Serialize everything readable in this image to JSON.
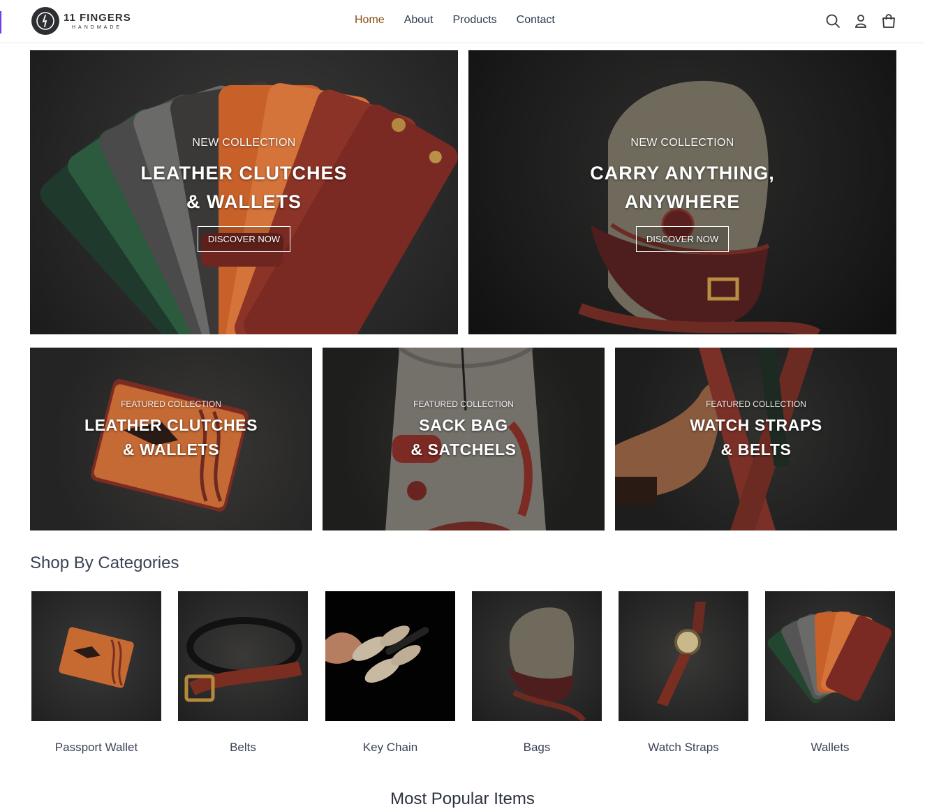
{
  "brand": {
    "name": "11 FINGERS",
    "sub": "HANDMADE"
  },
  "nav": [
    {
      "label": "Home",
      "active": true
    },
    {
      "label": "About",
      "active": false
    },
    {
      "label": "Products",
      "active": false
    },
    {
      "label": "Contact",
      "active": false
    }
  ],
  "header_icons": [
    "search-icon",
    "account-icon",
    "cart-icon"
  ],
  "hero": [
    {
      "kicker": "NEW COLLECTION",
      "title_line1": "LEATHER CLUTCHES",
      "title_line2": "& WALLETS",
      "button": "DISCOVER NOW"
    },
    {
      "kicker": "NEW COLLECTION",
      "title_line1": "CARRY ANYTHING,",
      "title_line2": "ANYWHERE",
      "button": "DISCOVER NOW"
    }
  ],
  "featured": [
    {
      "kicker": "FEATURED COLLECTION",
      "title_line1": "LEATHER CLUTCHES",
      "title_line2": "& WALLETS"
    },
    {
      "kicker": "FEATURED COLLECTION",
      "title_line1": "SACK BAG",
      "title_line2": "& SATCHELS"
    },
    {
      "kicker": "FEATURED COLLECTION",
      "title_line1": "WATCH STRAPS",
      "title_line2": "& BELTS"
    }
  ],
  "categories": {
    "title": "Shop By Categories",
    "items": [
      {
        "label": "Passport Wallet"
      },
      {
        "label": "Belts"
      },
      {
        "label": "Key Chain"
      },
      {
        "label": "Bags"
      },
      {
        "label": "Watch Straps"
      },
      {
        "label": "Wallets"
      }
    ]
  },
  "popular": {
    "title": "Most Popular Items"
  },
  "colors": {
    "accent": "#8a4b12",
    "text": "#3a4256",
    "leather": "#7a2e22"
  }
}
